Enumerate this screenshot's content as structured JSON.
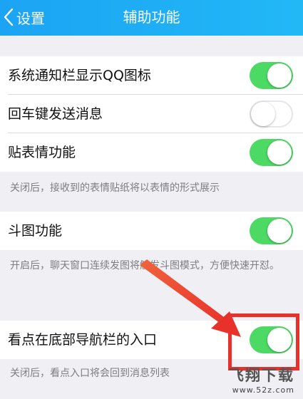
{
  "nav": {
    "back_label": "设置",
    "title": "辅助功能"
  },
  "settings": [
    {
      "label": "系统通知栏显示QQ图标",
      "enabled": true
    },
    {
      "label": "回车键发送消息",
      "enabled": false
    },
    {
      "label": "贴表情功能",
      "enabled": true
    },
    {
      "label": "斗图功能",
      "enabled": true
    },
    {
      "label": "看点在底部导航栏的入口",
      "enabled": true
    }
  ],
  "notes": {
    "sticker": "关闭后，接收到的表情贴纸将以表情的形式展示",
    "meme": "开启后，聊天窗口连续发图将触发斗图模式，方便快速开怼。",
    "kandian": "关闭后，看点入口将会回到消息列表"
  },
  "annotation": {
    "arrow_color": "#e8312a"
  },
  "watermark": {
    "logo": "飞翔下载",
    "url": "www.52z.com"
  },
  "colors": {
    "nav": "#1ba4f4",
    "toggle_on": "#4cd964"
  }
}
